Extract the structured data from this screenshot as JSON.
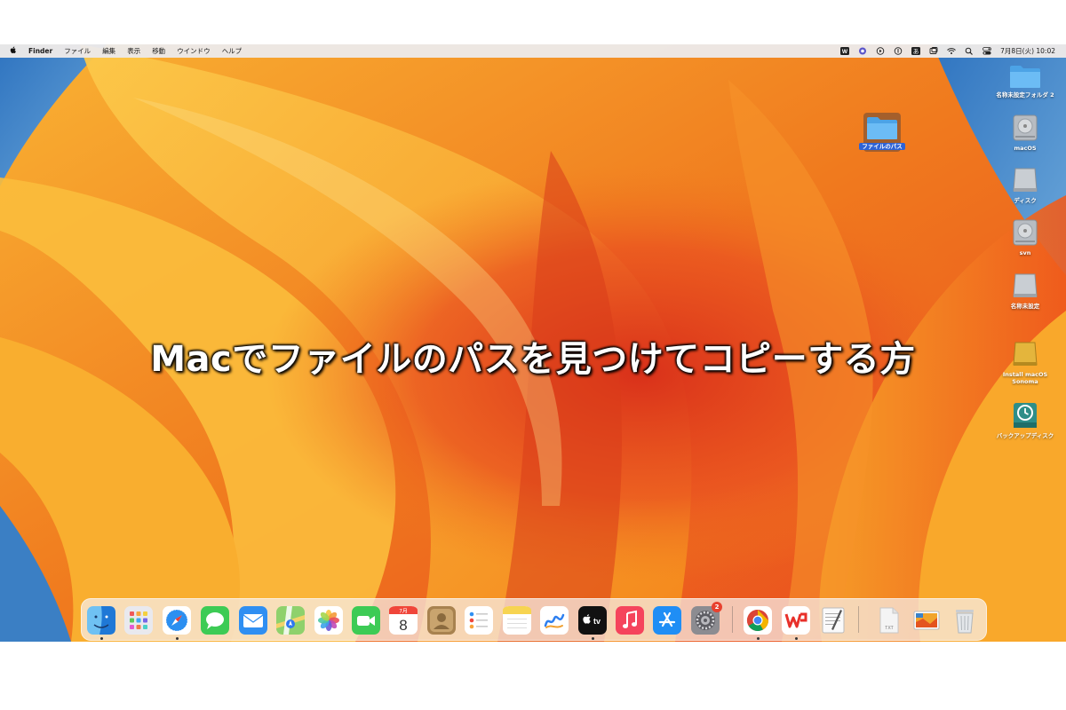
{
  "menubar": {
    "apple": "",
    "app_name": "Finder",
    "menus": [
      "ファイル",
      "編集",
      "表示",
      "移動",
      "ウインドウ",
      "ヘルプ"
    ],
    "status_icons": [
      "wps-icon",
      "screen-record-icon",
      "play-icon",
      "info-icon",
      "input-method-icon",
      "window-icon",
      "wifi-icon",
      "search-icon",
      "control-center-icon"
    ],
    "input_method": "あ",
    "wps_label": "W",
    "datetime": "7月8日(火) 10:02"
  },
  "desktop": {
    "selected_folder": "ファイルのパス",
    "right_column": [
      {
        "name": "名称未設定フォルダ 2",
        "icon": "folder-icon"
      },
      {
        "name": "macOS",
        "icon": "hard-disk-icon"
      },
      {
        "name": "ディスク",
        "icon": "external-disk-icon"
      },
      {
        "name": "svn",
        "icon": "hard-disk-icon"
      },
      {
        "name": "名称未設定",
        "icon": "external-disk-icon"
      },
      {
        "name": "Install macOS\nSonoma",
        "icon": "installer-disk-icon"
      },
      {
        "name": "バックアップディスク",
        "icon": "time-machine-icon"
      }
    ]
  },
  "caption": "Macでファイルのパスを見つけてコピーする方",
  "dock": {
    "apps": [
      {
        "name": "finder-icon",
        "running": true
      },
      {
        "name": "launchpad-icon",
        "running": false
      },
      {
        "name": "safari-icon",
        "running": true
      },
      {
        "name": "messages-icon",
        "running": false
      },
      {
        "name": "mail-icon",
        "running": false
      },
      {
        "name": "maps-icon",
        "running": false
      },
      {
        "name": "photos-icon",
        "running": false
      },
      {
        "name": "facetime-icon",
        "running": false
      },
      {
        "name": "calendar-icon",
        "running": false
      },
      {
        "name": "contacts-icon",
        "running": false
      },
      {
        "name": "reminders-icon",
        "running": false
      },
      {
        "name": "notes-icon",
        "running": false
      },
      {
        "name": "freeform-icon",
        "running": false
      },
      {
        "name": "apple-tv-icon",
        "running": true
      },
      {
        "name": "music-icon",
        "running": false
      },
      {
        "name": "app-store-icon",
        "running": false
      },
      {
        "name": "system-settings-icon",
        "running": false
      },
      {
        "name": "chrome-icon",
        "running": true
      },
      {
        "name": "wps-office-icon",
        "running": true
      },
      {
        "name": "textedit-icon",
        "running": false
      },
      {
        "name": "text-file-icon",
        "running": false
      },
      {
        "name": "screenshot-folder-icon",
        "running": false
      },
      {
        "name": "trash-icon",
        "running": false
      }
    ],
    "calendar_month": "7月",
    "calendar_day": "8",
    "tv_label": "tv",
    "settings_badge": "2",
    "txt_label": "TXT"
  },
  "colors": {
    "wallpaper_orange": "#f79a1f",
    "wallpaper_red": "#e9421c",
    "wallpaper_blue": "#3b82c6",
    "selection_blue": "#2e63d6"
  }
}
